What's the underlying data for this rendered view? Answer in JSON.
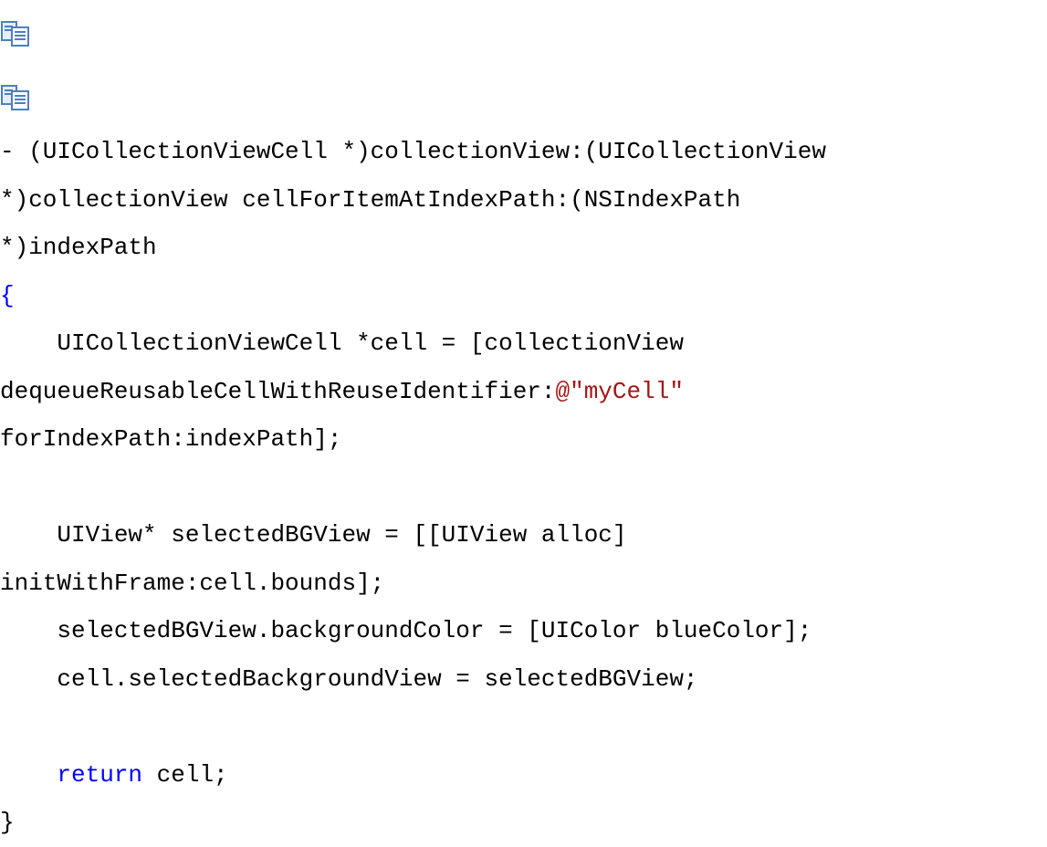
{
  "toolbar": {
    "icons": [
      "copy-icon",
      "copy-icon"
    ]
  },
  "colors": {
    "text": "#000000",
    "brace": "#0000ff",
    "string": "#a31515",
    "keyword": "#0000ff"
  },
  "code": {
    "lines": [
      {
        "segments": [
          {
            "text": "- (UICollectionViewCell *)collectionView:(UICollectionView",
            "style": "plain"
          }
        ]
      },
      {
        "segments": [
          {
            "text": "*)collectionView cellForItemAtIndexPath:(NSIndexPath",
            "style": "plain"
          }
        ]
      },
      {
        "segments": [
          {
            "text": "*)indexPath",
            "style": "plain"
          }
        ]
      },
      {
        "segments": [
          {
            "text": "{",
            "style": "brace"
          }
        ]
      },
      {
        "segments": [
          {
            "text": "    UICollectionViewCell *cell = [collectionView",
            "style": "plain"
          }
        ]
      },
      {
        "segments": [
          {
            "text": "dequeueReusableCellWithReuseIdentifier:",
            "style": "plain"
          },
          {
            "text": "@\"myCell\"",
            "style": "str"
          }
        ]
      },
      {
        "segments": [
          {
            "text": "forIndexPath:indexPath];",
            "style": "plain"
          }
        ]
      },
      {
        "segments": [
          {
            "text": "",
            "style": "plain"
          }
        ]
      },
      {
        "segments": [
          {
            "text": "    UIView* selectedBGView = [[UIView alloc]",
            "style": "plain"
          }
        ]
      },
      {
        "segments": [
          {
            "text": "initWithFrame:cell.bounds];",
            "style": "plain"
          }
        ]
      },
      {
        "segments": [
          {
            "text": "    selectedBGView.backgroundColor = [UIColor blueColor];",
            "style": "plain"
          }
        ]
      },
      {
        "segments": [
          {
            "text": "    cell.selectedBackgroundView = selectedBGView;",
            "style": "plain"
          }
        ]
      },
      {
        "segments": [
          {
            "text": "",
            "style": "plain"
          }
        ]
      },
      {
        "segments": [
          {
            "text": "    ",
            "style": "plain"
          },
          {
            "text": "return",
            "style": "kw"
          },
          {
            "text": " cell;",
            "style": "plain"
          }
        ]
      },
      {
        "segments": [
          {
            "text": "}",
            "style": "plain"
          }
        ]
      }
    ]
  }
}
